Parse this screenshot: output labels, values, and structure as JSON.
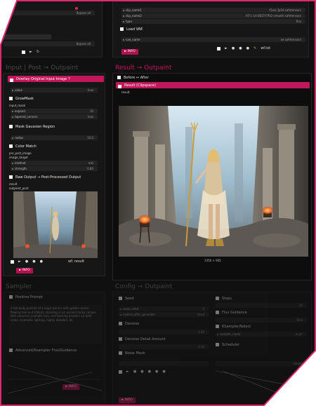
{
  "colors": {
    "accent": "#c2185b",
    "accent_dark": "#b0124f",
    "panel": "#161616",
    "bg": "#101010"
  },
  "top_right": {
    "rows": [
      {
        "label": "clip_name1",
        "value": "t5xxl_fp16.safetensors"
      },
      {
        "label": "clip_name2",
        "value": "ViT-L-14-BEST-FP32-smooth.safetensors"
      },
      {
        "label": "type",
        "value": "flux"
      }
    ],
    "load_vae": "Load VAE",
    "vae_row": {
      "label": "vae_name",
      "value": "ae.safetensors"
    },
    "info_button": "► INFO",
    "wf_label": "wf.txt"
  },
  "top_left": {
    "rows": [
      {
        "label": "",
        "value": "Bypass all"
      },
      {
        "label": "",
        "value": "Bypass all"
      }
    ]
  },
  "left_panel": {
    "title": "Input | Post → Outpaint",
    "overlay_bar": "Overlay Original Input Image ?",
    "value_row": {
      "label": "value",
      "value": "true"
    },
    "grow_mask": "GrowMask",
    "input_mask": "input_mask",
    "grow_rows": [
      {
        "label": "expand",
        "value": "10"
      },
      {
        "label": "tapered_corners",
        "value": "true"
      }
    ],
    "mask_gaussian": "Mask Gaussian Region",
    "radius_row": {
      "label": "radius",
      "value": "10.0"
    },
    "color_match": "Color Match",
    "color_inputs": [
      "pre_post_image",
      "image_target"
    ],
    "color_rows": [
      {
        "label": "method",
        "value": "mkl"
      },
      {
        "label": "strength",
        "value": "0.80"
      }
    ],
    "raw_output": "Raw Output → Post-Processed Output",
    "result_labels": [
      "result",
      "outpaint_post"
    ],
    "footer_wf": "wf: result",
    "info_button": "► INFO"
  },
  "center_panel": {
    "title": "Result → Outpaint",
    "before_after": "Before ↔ After",
    "result_bar": "Result (Clipspace)",
    "result_label": "result",
    "image_caption": "1350 × 945"
  },
  "bottom_left": {
    "title": "Sampler",
    "positive_label": "Positive Prompt",
    "prompt_text": "A full-body portrait of a regal warrior with golden armor, flowing hair and trident, standing in an ancient rocky canyon with columns, sunlight rays, and burning braziers on both sides, cinematic lighting, highly detailed, 8k.",
    "second_label": "Advanced/Ksampler Flux/Guidance",
    "info_button": "► INFO"
  },
  "bottom_right": {
    "title": "Config → Outpaint",
    "seed": "Seed",
    "seed_rows": [
      {
        "label": "noise_seed",
        "value": "0"
      },
      {
        "label": "control_after_generate",
        "value": "fixed"
      }
    ],
    "denoise": "Denoise",
    "denoise_val": "1.00",
    "detail": "Denoise Detail Amount",
    "detail_val": "0.10",
    "noise_mask": "Noise Mask",
    "steps": "Steps",
    "steps_val": "25",
    "flux_guidance": "Flux Guidance",
    "guidance_val": "30.0",
    "ksampler": "KSampler/Select",
    "sampler_name": "sampler_name",
    "sampler_val": "euler",
    "scheduler": "Scheduler",
    "scheduler_val": "simple",
    "info_button": "► INFO"
  }
}
